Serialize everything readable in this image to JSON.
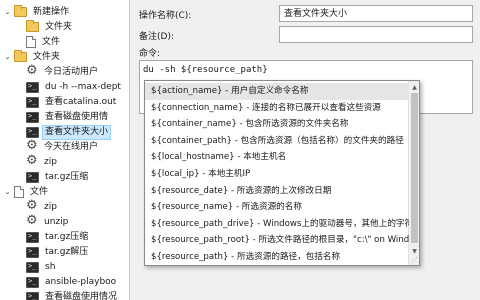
{
  "tree": {
    "items": [
      {
        "label": "新建操作",
        "icon": "folder-icon",
        "expander": "−",
        "depth": 0
      },
      {
        "label": "文件夹",
        "icon": "folder-icon",
        "expander": "",
        "depth": 1
      },
      {
        "label": "文件",
        "icon": "file-icon",
        "expander": "",
        "depth": 1
      },
      {
        "label": "文件夹",
        "icon": "folder-icon",
        "expander": "−",
        "depth": 0
      },
      {
        "label": "今日活动用户",
        "icon": "gear-icon",
        "expander": "",
        "depth": 1
      },
      {
        "label": "du -h --max-dept",
        "icon": "terminal-icon",
        "expander": "",
        "depth": 1
      },
      {
        "label": "查看catalina.out",
        "icon": "terminal-icon",
        "expander": "",
        "depth": 1
      },
      {
        "label": "查看磁盘使用情",
        "icon": "terminal-icon",
        "expander": "",
        "depth": 1
      },
      {
        "label": "查看文件夹大小",
        "icon": "terminal-icon",
        "expander": "",
        "depth": 1,
        "selected": true
      },
      {
        "label": "今天在线用户",
        "icon": "gear-icon",
        "expander": "",
        "depth": 1
      },
      {
        "label": "zip",
        "icon": "gear-icon",
        "expander": "",
        "depth": 1
      },
      {
        "label": "tar.gz压缩",
        "icon": "terminal-icon",
        "expander": "",
        "depth": 1
      },
      {
        "label": "文件",
        "icon": "file-icon",
        "expander": "−",
        "depth": 0
      },
      {
        "label": "zip",
        "icon": "gear-icon",
        "expander": "",
        "depth": 1
      },
      {
        "label": "unzip",
        "icon": "gear-icon",
        "expander": "",
        "depth": 1
      },
      {
        "label": "tar.gz压缩",
        "icon": "terminal-icon",
        "expander": "",
        "depth": 1
      },
      {
        "label": "tar.gz解压",
        "icon": "terminal-icon",
        "expander": "",
        "depth": 1
      },
      {
        "label": "sh",
        "icon": "terminal-icon",
        "expander": "",
        "depth": 1
      },
      {
        "label": "ansible-playboo",
        "icon": "terminal-icon",
        "expander": "",
        "depth": 1
      },
      {
        "label": "查看磁盘使用情况",
        "icon": "terminal-icon",
        "expander": "",
        "depth": 1
      }
    ]
  },
  "form": {
    "name_label": "操作名称(C):",
    "name_value": "查看文件夹大小",
    "remark_label": "备注(D):",
    "remark_value": "",
    "command_label": "命令:",
    "command_value": "du -sh ${resource_path}"
  },
  "popup": {
    "items": [
      "${action_name} - 用户自定义命令名称",
      "${connection_name} - 连接的名称已展开以查看这些资源",
      "${container_name} - 包含所选资源的文件夹名称",
      "${container_path} - 包含所选资源（包括名称）的文件夹的路径",
      "${local_hostname} - 本地主机名",
      "${local_ip} - 本地主机IP",
      "${resource_date} - 所选资源的上次修改日期",
      "${resource_name} - 所选资源的名称",
      "${resource_path_drive} - Windows上的驱动器号，其他上的字符",
      "${resource_path_root} - 所选文件路径的根目录，\"c:\\\" on Windo",
      "${resource_path} - 所选资源的路径，包括名称"
    ],
    "hover_index": 0
  }
}
